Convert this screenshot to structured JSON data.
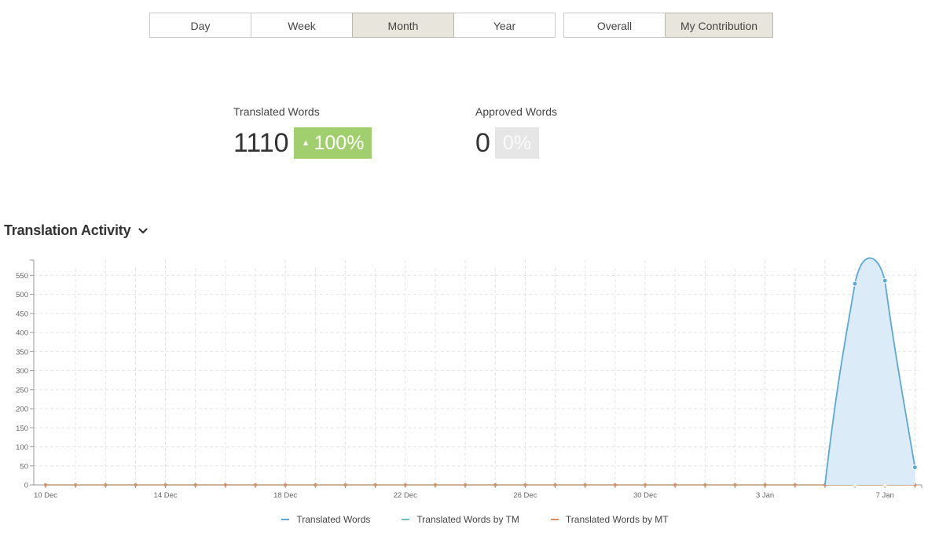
{
  "period_tabs": [
    {
      "label": "Day",
      "active": false
    },
    {
      "label": "Week",
      "active": false
    },
    {
      "label": "Month",
      "active": true
    },
    {
      "label": "Year",
      "active": false
    }
  ],
  "scope_tabs": [
    {
      "label": "Overall",
      "active": false
    },
    {
      "label": "My Contribution",
      "active": true
    }
  ],
  "stats": {
    "translated": {
      "label": "Translated Words",
      "value": "1110",
      "change": "100%",
      "trend": "up"
    },
    "approved": {
      "label": "Approved Words",
      "value": "0",
      "change": "0%",
      "trend": "none"
    }
  },
  "activity": {
    "title": "Translation Activity",
    "dropdown_icon": "chevron-down-icon"
  },
  "colors": {
    "translated": "#5aa9d6",
    "translated_fill": "#d9eaf7",
    "tm": "#6cc3b6",
    "mt": "#e08a5e",
    "active_tab": "#e8e5dc",
    "badge_up": "#a2cf6e",
    "badge_neutral": "#e6e6e6"
  },
  "chart_data": {
    "type": "area",
    "x_start": "10 Dec",
    "x_end": "8 Jan",
    "x_tick_labels": [
      "10 Dec",
      "14 Dec",
      "18 Dec",
      "22 Dec",
      "26 Dec",
      "30 Dec",
      "3 Jan",
      "7 Jan"
    ],
    "ylim": [
      0,
      590
    ],
    "y_ticks": [
      0,
      50,
      100,
      150,
      200,
      250,
      300,
      350,
      400,
      450,
      500,
      550
    ],
    "grid": true,
    "legend_position": "bottom-center",
    "series": [
      {
        "name": "Translated Words",
        "x": [
          "10 Dec",
          "11 Dec",
          "12 Dec",
          "13 Dec",
          "14 Dec",
          "15 Dec",
          "16 Dec",
          "17 Dec",
          "18 Dec",
          "19 Dec",
          "20 Dec",
          "21 Dec",
          "22 Dec",
          "23 Dec",
          "24 Dec",
          "25 Dec",
          "26 Dec",
          "27 Dec",
          "28 Dec",
          "29 Dec",
          "30 Dec",
          "31 Dec",
          "1 Jan",
          "2 Jan",
          "3 Jan",
          "4 Jan",
          "5 Jan",
          "6 Jan",
          "7 Jan",
          "8 Jan"
        ],
        "values": [
          0,
          0,
          0,
          0,
          0,
          0,
          0,
          0,
          0,
          0,
          0,
          0,
          0,
          0,
          0,
          0,
          0,
          0,
          0,
          0,
          0,
          0,
          0,
          0,
          0,
          0,
          0,
          528,
          536,
          46
        ],
        "markers_visible": [
          "6 Jan",
          "7 Jan",
          "8 Jan"
        ]
      },
      {
        "name": "Translated Words by TM",
        "x": [
          "10 Dec",
          "11 Dec",
          "12 Dec",
          "13 Dec",
          "14 Dec",
          "15 Dec",
          "16 Dec",
          "17 Dec",
          "18 Dec",
          "19 Dec",
          "20 Dec",
          "21 Dec",
          "22 Dec",
          "23 Dec",
          "24 Dec",
          "25 Dec",
          "26 Dec",
          "27 Dec",
          "28 Dec",
          "29 Dec",
          "30 Dec",
          "31 Dec",
          "1 Jan",
          "2 Jan",
          "3 Jan",
          "4 Jan",
          "5 Jan",
          "6 Jan",
          "7 Jan",
          "8 Jan"
        ],
        "values": [
          0,
          0,
          0,
          0,
          0,
          0,
          0,
          0,
          0,
          0,
          0,
          0,
          0,
          0,
          0,
          0,
          0,
          0,
          0,
          0,
          0,
          0,
          0,
          0,
          0,
          0,
          0,
          0,
          0,
          0
        ]
      },
      {
        "name": "Translated Words by MT",
        "x": [
          "10 Dec",
          "11 Dec",
          "12 Dec",
          "13 Dec",
          "14 Dec",
          "15 Dec",
          "16 Dec",
          "17 Dec",
          "18 Dec",
          "19 Dec",
          "20 Dec",
          "21 Dec",
          "22 Dec",
          "23 Dec",
          "24 Dec",
          "25 Dec",
          "26 Dec",
          "27 Dec",
          "28 Dec",
          "29 Dec",
          "30 Dec",
          "31 Dec",
          "1 Jan",
          "2 Jan",
          "3 Jan",
          "4 Jan",
          "5 Jan",
          "6 Jan",
          "7 Jan",
          "8 Jan"
        ],
        "values": [
          0,
          0,
          0,
          0,
          0,
          0,
          0,
          0,
          0,
          0,
          0,
          0,
          0,
          0,
          0,
          0,
          0,
          0,
          0,
          0,
          0,
          0,
          0,
          0,
          0,
          0,
          0,
          0,
          0,
          0
        ]
      }
    ]
  }
}
